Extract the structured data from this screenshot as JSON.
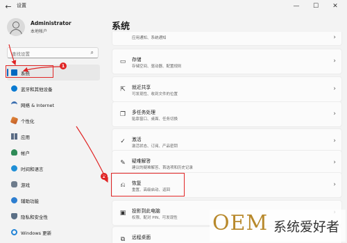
{
  "window": {
    "title": "设置",
    "back_icon": "back-arrow-icon",
    "minimize_glyph": "—",
    "maximize_glyph": "☐",
    "close_glyph": "✕"
  },
  "profile": {
    "name": "Administrator",
    "subtitle": "本地帐户"
  },
  "search": {
    "placeholder": "查找设置",
    "icon": "search-icon"
  },
  "sidebar": {
    "items": [
      {
        "label": "系统",
        "icon": "monitor-icon",
        "active": true
      },
      {
        "label": "蓝牙和其他设备",
        "icon": "bluetooth-icon"
      },
      {
        "label": "网络 & Internet",
        "icon": "wifi-icon"
      },
      {
        "label": "个性化",
        "icon": "brush-icon"
      },
      {
        "label": "应用",
        "icon": "apps-icon"
      },
      {
        "label": "帐户",
        "icon": "account-icon"
      },
      {
        "label": "时间和语言",
        "icon": "clock-globe-icon"
      },
      {
        "label": "游戏",
        "icon": "gamepad-icon"
      },
      {
        "label": "辅助功能",
        "icon": "accessibility-icon"
      },
      {
        "label": "隐私和安全性",
        "icon": "shield-icon"
      },
      {
        "label": "Windows 更新",
        "icon": "update-icon"
      }
    ]
  },
  "main": {
    "title": "系统",
    "cards": [
      {
        "title": "",
        "subtitle": "应用通知、系统通知",
        "icon": ""
      },
      {
        "title": "存储",
        "subtitle": "存储空间、驱动器、配置规则",
        "icon": "storage-icon"
      },
      {
        "title": "就近共享",
        "subtitle": "可发现性、收到文件的位置",
        "icon": "nearby-share-icon"
      },
      {
        "title": "多任务处理",
        "subtitle": "贴靠窗口、桌面、任务切换",
        "icon": "multitasking-icon"
      },
      {
        "title": "激活",
        "subtitle": "激活状态、订阅、产品密钥",
        "icon": "activation-icon"
      },
      {
        "title": "疑难解答",
        "subtitle": "建议的疑难解答、首选项和历史记录",
        "icon": "troubleshoot-icon"
      },
      {
        "title": "恢复",
        "subtitle": "重置、高级启动、返回",
        "icon": "recovery-icon"
      },
      {
        "title": "投影到此电脑",
        "subtitle": "权限、配对 PIN、可发现性",
        "icon": "projection-icon"
      },
      {
        "title": "远程桌面",
        "subtitle": "",
        "icon": "remote-desktop-icon"
      }
    ]
  },
  "annotations": {
    "step1": "1",
    "step2": "2",
    "color": "#e02424"
  },
  "watermark": {
    "brand": "OEM",
    "text": "系统爱好者"
  },
  "colors": {
    "accent": "#0067c0",
    "background": "#f3f3f3",
    "card": "#fbfbfb"
  }
}
